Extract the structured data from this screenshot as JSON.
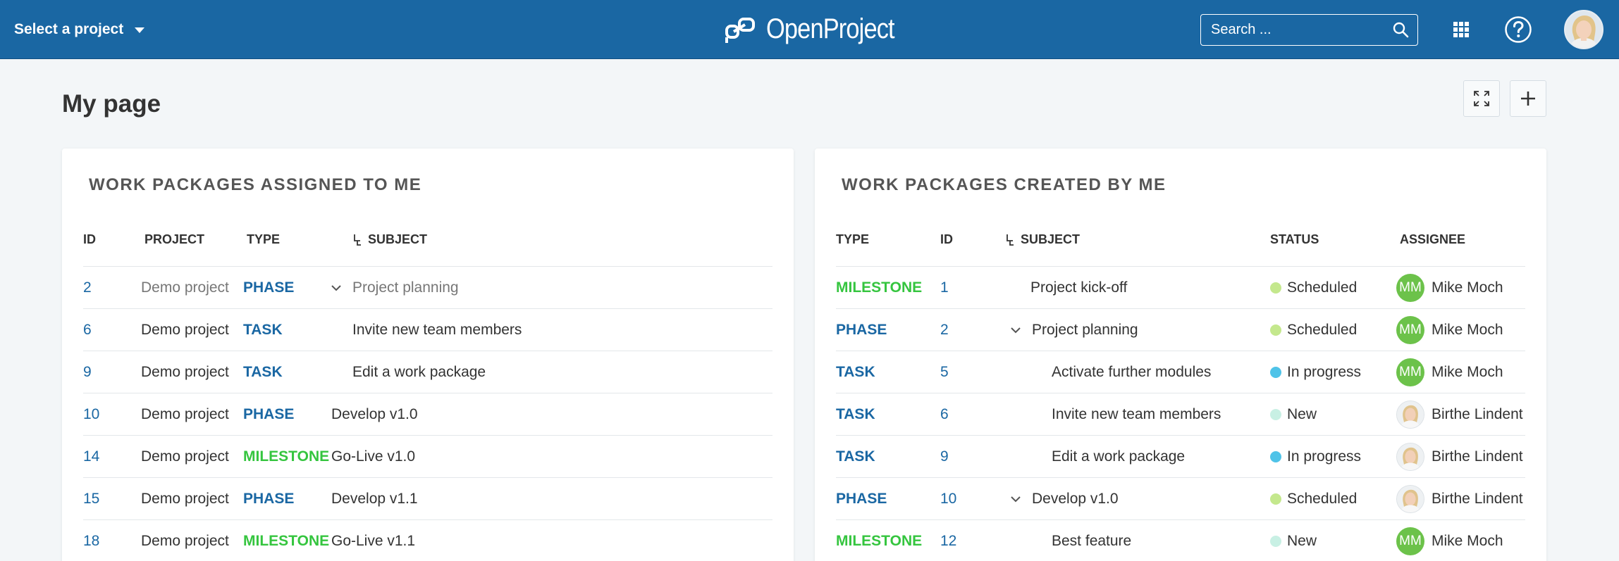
{
  "header": {
    "project_select": "Select a project",
    "logo_text": "OpenProject",
    "search_placeholder": "Search ...",
    "bg_color": "#1a67a3"
  },
  "page": {
    "title": "My page"
  },
  "widgets": {
    "assigned": {
      "title": "WORK PACKAGES ASSIGNED TO ME",
      "columns": [
        "ID",
        "PROJECT",
        "TYPE",
        "SUBJECT"
      ],
      "rows": [
        {
          "id": "2",
          "project": "Demo project",
          "type": "PHASE",
          "subject": "Project planning"
        },
        {
          "id": "6",
          "project": "Demo project",
          "type": "TASK",
          "subject": "Invite new team members"
        },
        {
          "id": "9",
          "project": "Demo project",
          "type": "TASK",
          "subject": "Edit a work package"
        },
        {
          "id": "10",
          "project": "Demo project",
          "type": "PHASE",
          "subject": "Develop v1.0"
        },
        {
          "id": "14",
          "project": "Demo project",
          "type": "MILESTONE",
          "subject": "Go-Live v1.0"
        },
        {
          "id": "15",
          "project": "Demo project",
          "type": "PHASE",
          "subject": "Develop v1.1"
        },
        {
          "id": "18",
          "project": "Demo project",
          "type": "MILESTONE",
          "subject": "Go-Live v1.1"
        }
      ]
    },
    "created": {
      "title": "WORK PACKAGES CREATED BY ME",
      "columns": [
        "TYPE",
        "ID",
        "SUBJECT",
        "STATUS",
        "ASSIGNEE"
      ],
      "rows": [
        {
          "type": "MILESTONE",
          "id": "1",
          "subject": "Project kick-off",
          "status": "Scheduled",
          "assignee": "Mike Moch",
          "initials": "MM"
        },
        {
          "type": "PHASE",
          "id": "2",
          "subject": "Project planning",
          "status": "Scheduled",
          "assignee": "Mike Moch",
          "initials": "MM"
        },
        {
          "type": "TASK",
          "id": "5",
          "subject": "Activate further modules",
          "status": "In progress",
          "assignee": "Mike Moch",
          "initials": "MM"
        },
        {
          "type": "TASK",
          "id": "6",
          "subject": "Invite new team members",
          "status": "New",
          "assignee": "Birthe Lindent"
        },
        {
          "type": "TASK",
          "id": "9",
          "subject": "Edit a work package",
          "status": "In progress",
          "assignee": "Birthe Lindent"
        },
        {
          "type": "PHASE",
          "id": "10",
          "subject": "Develop v1.0",
          "status": "Scheduled",
          "assignee": "Birthe Lindent"
        },
        {
          "type": "MILESTONE",
          "id": "12",
          "subject": "Best feature",
          "status": "New",
          "assignee": "Mike Moch",
          "initials": "MM"
        }
      ]
    }
  },
  "colors": {
    "phase": "#1a67a3",
    "task": "#1a67a3",
    "milestone": "#35c53f",
    "status_scheduled": "#c4e88d",
    "status_in_progress": "#4fc3e8",
    "status_new": "#c8f0e4"
  }
}
